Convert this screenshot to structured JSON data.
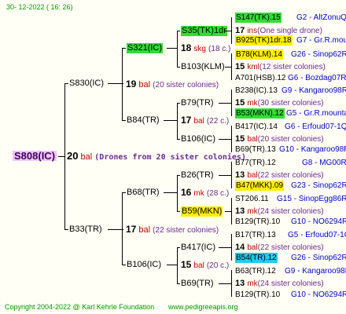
{
  "header": {
    "date": "30- 12-2022 ( 16: 26)"
  },
  "footer": {
    "copyright": "Copyright 2004-2022 @ Karl Kehrle Foundation",
    "site": "www.pedigreeapis.org"
  },
  "root": {
    "name": "S808(IC)",
    "count": "20",
    "unit": "bal",
    "note": "(Drones from 20 sister colonies)"
  },
  "gen1": [
    {
      "name": "S830(IC)",
      "count": "19",
      "unit": "bal",
      "note": "(20 sister colonies)"
    },
    {
      "name": "B33(TR)",
      "count": "17",
      "unit": "bal",
      "note": "(22 sister colonies)"
    }
  ],
  "gen2": [
    {
      "name": "S321(IC)",
      "count": "18",
      "unit": "skg",
      "note": "(18 c.)"
    },
    {
      "name": "B84(TR)",
      "count": "17",
      "unit": "bal",
      "note": "(22 c.)"
    },
    {
      "name": "B68(TR)",
      "count": "16",
      "unit": "mk",
      "note": "(28 c.)"
    },
    {
      "name": "B106(IC)",
      "count": "15",
      "unit": "bal",
      "note": "(20 c.)"
    }
  ],
  "gen3": [
    {
      "name": "S35(TK)1dr",
      "count": "17",
      "unit": "ins",
      "note": "(One single drone)"
    },
    {
      "name": "B103(KLM)",
      "count": "15",
      "unit": "kml",
      "note": "(12 sister colonies)"
    },
    {
      "name": "B79(TR)",
      "count": "15",
      "unit": "mk",
      "note": "(30 sister colonies)"
    },
    {
      "name": "B106(IC)",
      "count": "15",
      "unit": "bal",
      "note": "(20 sister colonies)"
    },
    {
      "name": "B26(TR)",
      "count": "13",
      "unit": "bal",
      "note": "(22 sister colonies)"
    },
    {
      "name": "B59(MKN)",
      "count": "13",
      "unit": "mk",
      "note": "(24 sister colonies)"
    },
    {
      "name": "B417(IC)",
      "count": "14",
      "unit": "bal",
      "note": "(22 sister colonies)"
    },
    {
      "name": "B69(TR)",
      "count": "13",
      "unit": "mk",
      "note": "(24 sister colonies)"
    }
  ],
  "gen4": [
    {
      "name": "S147(TK).15",
      "code": "G2 - AltZonuQ"
    },
    {
      "name": "B925(TK)1dr.18",
      "code": "G7 - Gr.R.mounta"
    },
    {
      "name": "B78(KLM).14",
      "code": "G26 - Sinop62R"
    },
    {
      "name": "A701(HSB).12",
      "code": "G6 - Bozdag07R"
    },
    {
      "name": "B238(IC).13",
      "code": "G9 - Kangaroo98R"
    },
    {
      "name": "B53(MKN).12",
      "code": "G5 - Gr.R.mounta"
    },
    {
      "name": "B417(IC).14",
      "code": "G6 - Erfoud07-1Q"
    },
    {
      "name": "B69(TR).13",
      "code": "G10 - Kangaroo98R"
    },
    {
      "name": "B77(TR).12",
      "code": "G8 - MG00R"
    },
    {
      "name": "B47(MKK).09",
      "code": "G23 - Sinop62R"
    },
    {
      "name": "ST206.11",
      "code": "G15 - SinopEgg86R"
    },
    {
      "name": "B129(TR).10",
      "code": "G10 - NO6294R"
    },
    {
      "name": "B17(TR).13",
      "code": "G5 - Erfoud07-1Q"
    },
    {
      "name": "B54(TR).12",
      "code": "G26 - Sinop62R"
    },
    {
      "name": "B63(TR).12",
      "code": "G9 - Kangaroo98R"
    },
    {
      "name": "B129(TR).10",
      "code": "G10 - NO6294R"
    }
  ]
}
